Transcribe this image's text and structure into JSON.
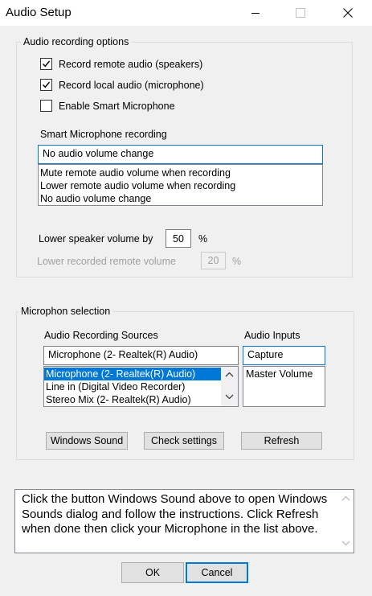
{
  "window": {
    "title": "Audio Setup",
    "minimize_glyph": "—",
    "maximize_glyph": "☐",
    "close_glyph": "✕"
  },
  "recording": {
    "group_label": "Audio recording options",
    "options": [
      {
        "label": "Record remote audio (speakers)",
        "checked": true
      },
      {
        "label": "Record local audio (microphone)",
        "checked": true
      },
      {
        "label": "Enable Smart Microphone",
        "checked": false
      }
    ],
    "smart_mic_label": "Smart Microphone recording",
    "smart_mic_value": "No audio volume change",
    "smart_mic_options": [
      "Mute remote audio volume when recording",
      "Lower remote audio volume when recording",
      "No audio volume change"
    ],
    "lower_speaker_label": "Lower speaker volume by",
    "lower_speaker_value": "50",
    "lower_speaker_unit": "%",
    "lower_remote_label": "Lower recorded remote volume",
    "lower_remote_value": "20",
    "lower_remote_unit": "%"
  },
  "microphone": {
    "group_label": "Microphon selection",
    "sources_label": "Audio Recording Sources",
    "sources_value": "Microphone (2- Realtek(R) Audio)",
    "sources_options": [
      "Microphone (2- Realtek(R) Audio)",
      "Line in (Digital Video Recorder)",
      "Stereo Mix (2- Realtek(R) Audio)"
    ],
    "inputs_label": "Audio Inputs",
    "inputs_value": "Capture",
    "inputs_options": [
      "Master Volume"
    ],
    "buttons": {
      "windows_sound": "Windows Sound",
      "check_settings": "Check settings",
      "refresh": "Refresh"
    }
  },
  "instructions": "Click the button Windows Sound above to open Windows Sounds dialog and follow the instructions. Click Refresh when done then click your Microphone in the list above.",
  "footer": {
    "ok": "OK",
    "cancel": "Cancel"
  },
  "colors": {
    "accent": "#0078d7",
    "background": "#f0f0f0"
  }
}
